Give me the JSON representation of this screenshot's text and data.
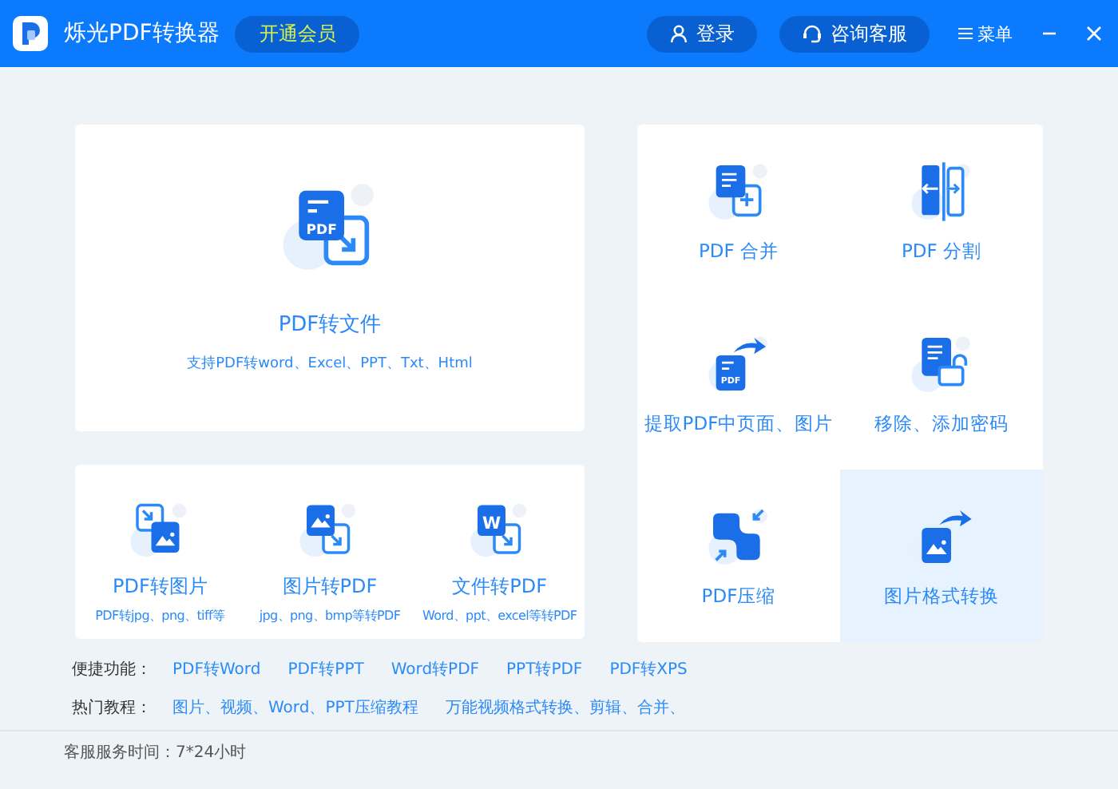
{
  "header": {
    "title": "烁光PDF转换器",
    "vip_button": "开通会员",
    "login_button": "登录",
    "service_button": "咨询客服",
    "menu_label": "菜单"
  },
  "main_card": {
    "kind": "convert",
    "icon_text": "PDF",
    "title": "PDF转文件",
    "subtitle": "支持PDF转word、Excel、PPT、Txt、Html"
  },
  "small_cards": [
    {
      "kind": "pdf-to-image",
      "title": "PDF转图片",
      "subtitle": "PDF转jpg、png、tiff等"
    },
    {
      "kind": "image-to-pdf",
      "title": "图片转PDF",
      "subtitle": "jpg、png、bmp等转PDF"
    },
    {
      "kind": "word",
      "icon_text": "W",
      "title": "文件转PDF",
      "subtitle": "Word、ppt、excel等转PDF"
    }
  ],
  "tools": [
    {
      "kind": "merge",
      "label": "PDF 合并",
      "selected": false
    },
    {
      "kind": "split",
      "label": "PDF 分割",
      "selected": false
    },
    {
      "kind": "extract",
      "icon_text": "PDF",
      "label": "提取PDF中页面、图片",
      "selected": false
    },
    {
      "kind": "password",
      "label": "移除、添加密码",
      "selected": false
    },
    {
      "kind": "compress",
      "label": "PDF压缩",
      "selected": false
    },
    {
      "kind": "image-convert",
      "label": "图片格式转换",
      "selected": true
    }
  ],
  "quick_links": {
    "label": "便捷功能：",
    "items": [
      "PDF转Word",
      "PDF转PPT",
      "Word转PDF",
      "PPT转PDF",
      "PDF转XPS"
    ]
  },
  "hot_tutorials": {
    "label": "热门教程：",
    "items": [
      "图片、视频、Word、PPT压缩教程",
      "万能视频格式转换、剪辑、合并、"
    ]
  },
  "status_bar": "客服服务时间：7*24小时"
}
